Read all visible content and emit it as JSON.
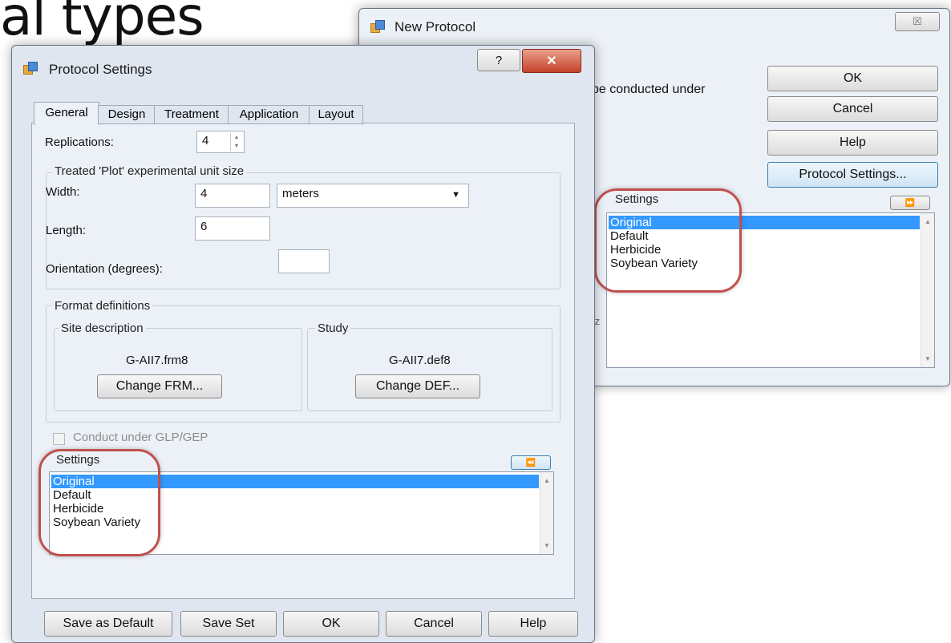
{
  "slide": {
    "title_fragment": "al types"
  },
  "new_protocol": {
    "title": "New Protocol",
    "close_glyph": "☒",
    "text_fragment": "be conducted under",
    "side_fragment": "fz",
    "buttons": {
      "ok": "OK",
      "cancel": "Cancel",
      "help": "Help",
      "protocol_settings": "Protocol Settings..."
    },
    "settings_label": "Settings",
    "collapse_glyph": "⏩",
    "settings_items": [
      "Original",
      "Default",
      "Herbicide",
      "Soybean Variety"
    ],
    "selected_index": 0
  },
  "protocol_settings": {
    "title": "Protocol Settings",
    "help_glyph": "?",
    "close_glyph": "✕",
    "tabs": [
      "General",
      "Design",
      "Treatment",
      "Application",
      "Layout"
    ],
    "active_tab": "General",
    "replications_label": "Replications:",
    "replications_value": "4",
    "plot_group_label": "Treated 'Plot' experimental unit size",
    "width_label": "Width:",
    "width_value": "4",
    "units_value": "meters",
    "length_label": "Length:",
    "length_value": "6",
    "orientation_label": "Orientation (degrees):",
    "orientation_value": "",
    "format_group_label": "Format definitions",
    "site_group_label": "Site description",
    "site_file": "G-AII7.frm8",
    "change_frm": "Change FRM...",
    "study_group_label": "Study",
    "study_file": "G-AII7.def8",
    "change_def": "Change DEF...",
    "glp_label": "Conduct under GLP/GEP",
    "settings_label": "Settings",
    "expand_glyph": "⏪",
    "settings_items": [
      "Original",
      "Default",
      "Herbicide",
      "Soybean Variety"
    ],
    "selected_index": 0,
    "buttons": {
      "save_default": "Save as Default",
      "save_set": "Save Set",
      "ok": "OK",
      "cancel": "Cancel",
      "help": "Help"
    }
  }
}
